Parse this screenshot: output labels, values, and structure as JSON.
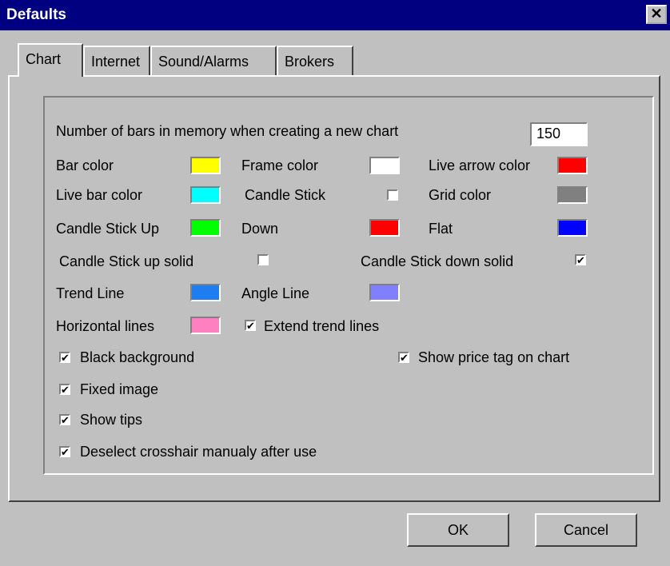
{
  "window": {
    "title": "Defaults",
    "close_glyph": "✕"
  },
  "tabs": [
    "Chart",
    "Internet",
    "Sound/Alarms",
    "Brokers"
  ],
  "bars_label": "Number of bars in memory when creating a new chart",
  "bars_value": "150",
  "labels": {
    "bar_color": "Bar color",
    "frame_color": "Frame color",
    "live_arrow_color": "Live arrow color",
    "live_bar_color": "Live bar color",
    "candle_stick": "Candle Stick",
    "grid_color": "Grid color",
    "candle_stick_up": "Candle Stick Up",
    "down": "Down",
    "flat": "Flat",
    "candle_up_solid": "Candle Stick up solid",
    "candle_down_solid": "Candle Stick down solid",
    "trend_line": "Trend Line",
    "angle_line": "Angle Line",
    "horizontal_lines": "Horizontal lines",
    "extend_trend_lines": "Extend trend lines",
    "black_background": "Black background",
    "show_price_tag": "Show price tag on chart",
    "fixed_image": "Fixed image",
    "show_tips": "Show tips",
    "deselect_crosshair": "Deselect crosshair manualy after use"
  },
  "checkbox_states": {
    "candle_stick": false,
    "candle_up_solid": false,
    "candle_down_solid": true,
    "extend_trend_lines": true,
    "black_background": true,
    "show_price_tag": true,
    "fixed_image": true,
    "show_tips": true,
    "deselect_crosshair": true
  },
  "colors": {
    "bar": "#ffff00",
    "frame": "#ffffff",
    "live_arrow": "#ff0000",
    "live_bar": "#00ffff",
    "grid": "#808080",
    "candle_up": "#00ff00",
    "down": "#ff0000",
    "flat": "#0000ff",
    "trend_line": "#1e7ef0",
    "angle_line": "#8080ff",
    "horizontal_lines": "#ff80c0"
  },
  "buttons": {
    "ok": "OK",
    "cancel": "Cancel"
  }
}
